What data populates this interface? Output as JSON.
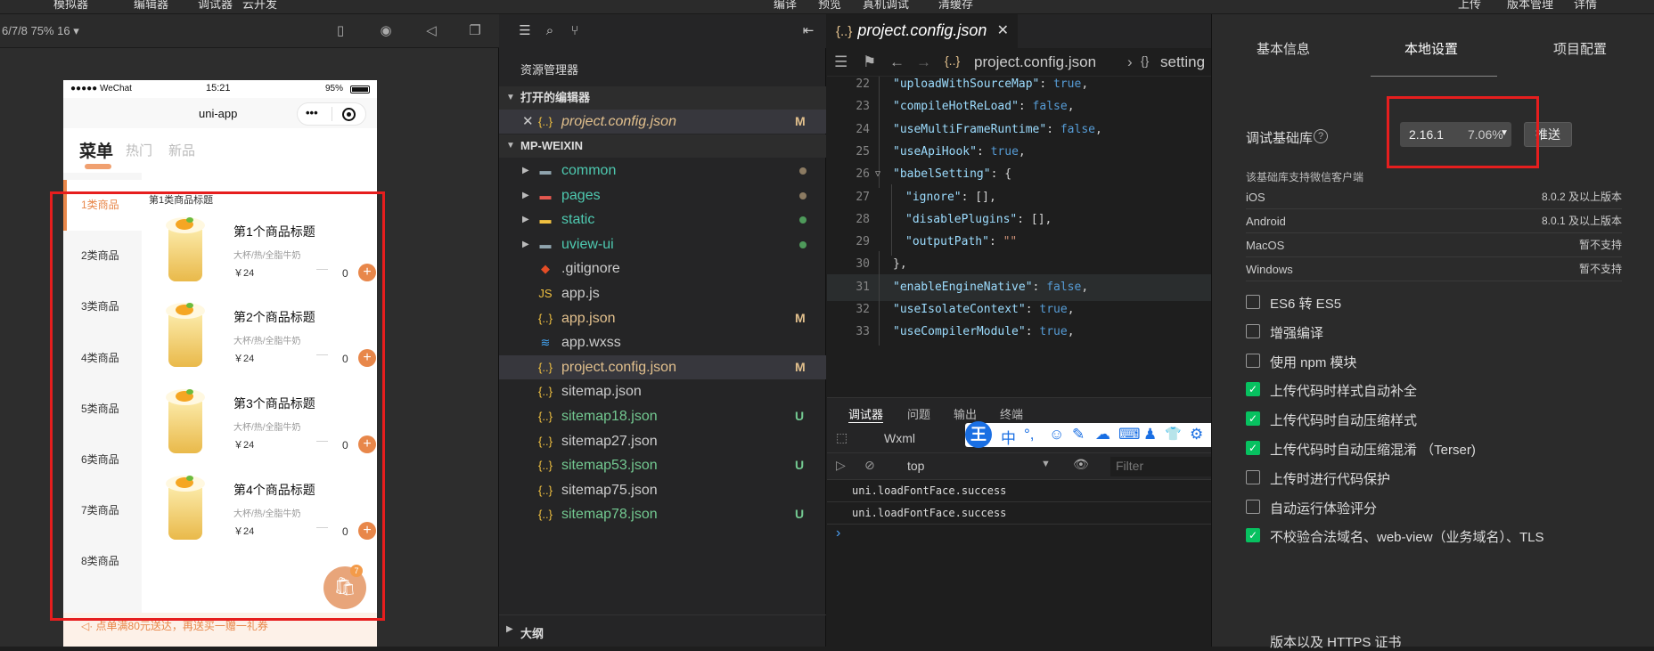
{
  "menubar": {
    "items": [
      "模拟器",
      "编辑器",
      "调试器",
      "云开发",
      "编译",
      "预览",
      "真机调试",
      "清缓存",
      "上传",
      "版本管理",
      "详情"
    ]
  },
  "simulator": {
    "device_label": "6/7/8 75% 16 ▾",
    "status": {
      "carrier": "●●●●● WeChat",
      "time": "15:21",
      "battery": "95%"
    },
    "nav_title": "uni-app",
    "tabs": [
      "菜单",
      "热门",
      "新品"
    ],
    "categories": [
      "1类商品",
      "2类商品",
      "3类商品",
      "4类商品",
      "5类商品",
      "6类商品",
      "7类商品",
      "8类商品"
    ],
    "section_title": "第1类商品标题",
    "products": [
      {
        "name": "第1个商品标题",
        "desc": "大杯/热/全脂牛奶",
        "price": "￥24",
        "minus": "—",
        "qty": "0",
        "add": "+"
      },
      {
        "name": "第2个商品标题",
        "desc": "大杯/热/全脂牛奶",
        "price": "￥24",
        "minus": "—",
        "qty": "0",
        "add": "+"
      },
      {
        "name": "第3个商品标题",
        "desc": "大杯/热/全脂牛奶",
        "price": "￥24",
        "minus": "—",
        "qty": "0",
        "add": "+"
      },
      {
        "name": "第4个商品标题",
        "desc": "大杯/热/全脂牛奶",
        "price": "￥24",
        "minus": "—",
        "qty": "0",
        "add": "+"
      }
    ],
    "cart_badge": "7",
    "promo": "◁· 点单满80元送达，再送买一赠一礼券"
  },
  "explorer": {
    "title": "资源管理器",
    "open_editors_label": "打开的编辑器",
    "open_file": {
      "name": "project.config.json",
      "badge": "M"
    },
    "project_label": "MP-WEIXIN",
    "files": [
      {
        "name": "common",
        "icon": "folder-icon",
        "kind": "folder",
        "color": "#4ec9b0",
        "iconColor": "#90a4ae",
        "dot": "#8c7b62"
      },
      {
        "name": "pages",
        "icon": "folder-pages-icon",
        "kind": "folder",
        "color": "#4ec9b0",
        "iconColor": "#e5584f",
        "dot": "#8c7b62"
      },
      {
        "name": "static",
        "icon": "folder-static-icon",
        "kind": "folder",
        "color": "#4ec9b0",
        "iconColor": "#f0c040",
        "dot": "#4e9a5a"
      },
      {
        "name": "uview-ui",
        "icon": "folder-icon",
        "kind": "folder",
        "color": "#4ec9b0",
        "iconColor": "#90a4ae",
        "dot": "#4e9a5a"
      },
      {
        "name": ".gitignore",
        "icon": "git-icon",
        "kind": "file",
        "color": "#ccc",
        "iconColor": "#e44d26",
        "badge": ""
      },
      {
        "name": "app.js",
        "icon": "js-icon",
        "kind": "file",
        "color": "#ccc",
        "iconColor": "#f0c040",
        "badge": ""
      },
      {
        "name": "app.json",
        "icon": "json-icon",
        "kind": "file",
        "color": "#e2c08d",
        "iconColor": "#f0c040",
        "badge": "M",
        "badgeColor": "#e2c08d"
      },
      {
        "name": "app.wxss",
        "icon": "css-icon",
        "kind": "file",
        "color": "#ccc",
        "iconColor": "#42a5f5",
        "badge": ""
      },
      {
        "name": "project.config.json",
        "icon": "json-icon",
        "kind": "file",
        "color": "#e2c08d",
        "iconColor": "#f0c040",
        "badge": "M",
        "badgeColor": "#e2c08d",
        "selected": true
      },
      {
        "name": "sitemap.json",
        "icon": "json-icon",
        "kind": "file",
        "color": "#ccc",
        "iconColor": "#f0c040",
        "badge": ""
      },
      {
        "name": "sitemap18.json",
        "icon": "json-icon",
        "kind": "file",
        "color": "#73c991",
        "iconColor": "#f0c040",
        "badge": "U",
        "badgeColor": "#73c991"
      },
      {
        "name": "sitemap27.json",
        "icon": "json-icon",
        "kind": "file",
        "color": "#ccc",
        "iconColor": "#f0c040",
        "badge": ""
      },
      {
        "name": "sitemap53.json",
        "icon": "json-icon",
        "kind": "file",
        "color": "#73c991",
        "iconColor": "#f0c040",
        "badge": "U",
        "badgeColor": "#73c991"
      },
      {
        "name": "sitemap75.json",
        "icon": "json-icon",
        "kind": "file",
        "color": "#ccc",
        "iconColor": "#f0c040",
        "badge": ""
      },
      {
        "name": "sitemap78.json",
        "icon": "json-icon",
        "kind": "file",
        "color": "#73c991",
        "iconColor": "#f0c040",
        "badge": "U",
        "badgeColor": "#73c991"
      }
    ],
    "outline_label": "大纲"
  },
  "editor": {
    "tab": "project.config.json",
    "breadcrumb": {
      "file": "project.config.json",
      "section": "setting"
    },
    "lines": [
      {
        "n": "22",
        "indent": 1,
        "key": "uploadWithSourceMap",
        "val": "true",
        "vt": "b",
        "end": ","
      },
      {
        "n": "23",
        "indent": 1,
        "key": "compileHotReLoad",
        "val": "false",
        "vt": "b",
        "end": ","
      },
      {
        "n": "24",
        "indent": 1,
        "key": "useMultiFrameRuntime",
        "val": "false",
        "vt": "b",
        "end": ","
      },
      {
        "n": "25",
        "indent": 1,
        "key": "useApiHook",
        "val": "true",
        "vt": "b",
        "end": ","
      },
      {
        "n": "26",
        "indent": 1,
        "key": "babelSetting",
        "val": "{",
        "vt": "p",
        "end": ""
      },
      {
        "n": "27",
        "indent": 2,
        "key": "ignore",
        "val": "[]",
        "vt": "p",
        "end": ","
      },
      {
        "n": "28",
        "indent": 2,
        "key": "disablePlugins",
        "val": "[]",
        "vt": "p",
        "end": ","
      },
      {
        "n": "29",
        "indent": 2,
        "key": "outputPath",
        "val": "\"\"",
        "vt": "s",
        "end": ""
      },
      {
        "n": "30",
        "indent": 1,
        "key": "",
        "val": "},",
        "vt": "p",
        "end": ""
      },
      {
        "n": "31",
        "indent": 1,
        "key": "enableEngineNative",
        "val": "false",
        "vt": "b",
        "end": ",",
        "hl": true
      },
      {
        "n": "32",
        "indent": 1,
        "key": "useIsolateContext",
        "val": "true",
        "vt": "b",
        "end": ","
      },
      {
        "n": "33",
        "indent": 1,
        "key": "useCompilerModule",
        "val": "true",
        "vt": "b",
        "end": ","
      }
    ],
    "devtools": {
      "tabs": [
        "调试器",
        "问题",
        "输出",
        "终端"
      ],
      "sub_tab": "Wxml",
      "context": "top",
      "filter_placeholder": "Filter",
      "logs": [
        "uni.loadFontFace.success",
        "uni.loadFontFace.success"
      ],
      "prompt": "›"
    },
    "ime": {
      "logo": "王",
      "items": [
        "中",
        "°,",
        "☺",
        "✎",
        "☁",
        "⌨",
        "♟",
        "👕",
        "⚙"
      ]
    }
  },
  "settings": {
    "tabs": [
      "基本信息",
      "本地设置",
      "项目配置"
    ],
    "debug_lib_label": "调试基础库",
    "lib_version": "2.16.1",
    "lib_share": "7.06%",
    "push_label": "推送",
    "support_title": "该基础库支持微信客户端",
    "os_support": [
      {
        "os": "iOS",
        "ver": "8.0.2 及以上版本"
      },
      {
        "os": "Android",
        "ver": "8.0.1 及以上版本"
      },
      {
        "os": "MacOS",
        "ver": "暂不支持"
      },
      {
        "os": "Windows",
        "ver": "暂不支持"
      }
    ],
    "options": [
      {
        "label": "ES6 转 ES5",
        "checked": false
      },
      {
        "label": "增强编译",
        "checked": false
      },
      {
        "label": "使用 npm 模块",
        "checked": false
      },
      {
        "label": "上传代码时样式自动补全",
        "checked": true
      },
      {
        "label": "上传代码时自动压缩样式",
        "checked": true
      },
      {
        "label": "上传代码时自动压缩混淆 （Terser)",
        "checked": true
      },
      {
        "label": "上传时进行代码保护",
        "checked": false
      },
      {
        "label": "自动运行体验评分",
        "checked": false
      },
      {
        "label": "不校验合法域名、web-view（业务域名）、TLS",
        "checked": true
      }
    ],
    "option_continuation": "版本以及 HTTPS 证书"
  }
}
